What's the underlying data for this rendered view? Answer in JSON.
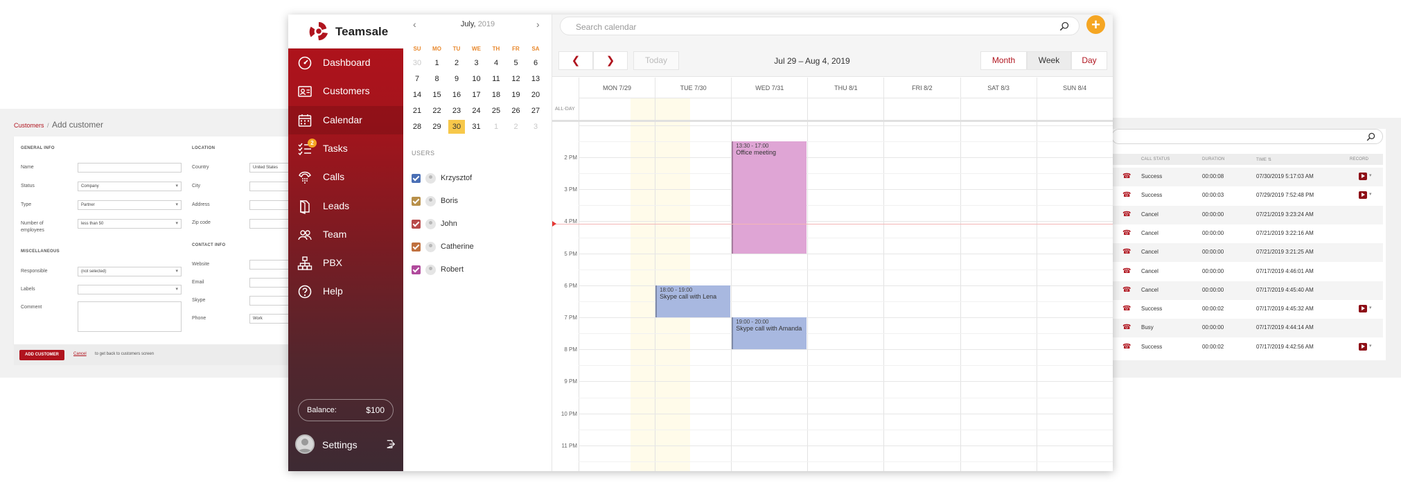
{
  "add_customer": {
    "breadcrumb_link": "Customers",
    "breadcrumb_sep": "/",
    "title": "Add customer",
    "general_info": "GENERAL INFO",
    "miscellaneous": "MISCELLANEOUS",
    "location": "LOCATION",
    "contact_info": "CONTACT INFO",
    "fields": {
      "name": "Name",
      "status": "Status",
      "status_value": "Company",
      "type": "Type",
      "type_value": "Partner",
      "employees": "Number of employees",
      "employees_value": "less than 50",
      "responsible": "Responsible",
      "responsible_value": "(not selected)",
      "labels": "Labels",
      "comment": "Comment",
      "country": "Country",
      "country_value": "United States",
      "city": "City",
      "address": "Address",
      "zip": "Zip code",
      "website": "Website",
      "email": "Email",
      "skype": "Skype",
      "phone": "Phone",
      "phone_value": "Work"
    },
    "submit": "ADD CUSTOMER",
    "cancel": "Cancel",
    "cancel_note": "to get back to customers screen"
  },
  "calls": {
    "columns": {
      "status": "CALL STATUS",
      "duration": "DURATION",
      "time": "TIME ⇅",
      "record": "RECORD"
    },
    "rows": [
      {
        "status": "Success",
        "duration": "00:00:08",
        "time": "07/30/2019 5:17:03 AM",
        "record": true
      },
      {
        "status": "Success",
        "duration": "00:00:03",
        "time": "07/29/2019 7:52:48 PM",
        "record": true
      },
      {
        "status": "Cancel",
        "duration": "00:00:00",
        "time": "07/21/2019 3:23:24 AM",
        "record": false
      },
      {
        "status": "Cancel",
        "duration": "00:00:00",
        "time": "07/21/2019 3:22:16 AM",
        "record": false
      },
      {
        "status": "Cancel",
        "duration": "00:00:00",
        "time": "07/21/2019 3:21:25 AM",
        "record": false
      },
      {
        "status": "Cancel",
        "duration": "00:00:00",
        "time": "07/17/2019 4:46:01 AM",
        "record": false
      },
      {
        "status": "Cancel",
        "duration": "00:00:00",
        "time": "07/17/2019 4:45:40 AM",
        "record": false
      },
      {
        "status": "Success",
        "duration": "00:00:02",
        "time": "07/17/2019 4:45:32 AM",
        "record": true
      },
      {
        "status": "Busy",
        "duration": "00:00:00",
        "time": "07/17/2019 4:44:14 AM",
        "record": false
      },
      {
        "status": "Success",
        "duration": "00:00:02",
        "time": "07/17/2019 4:42:56 AM",
        "record": true
      }
    ]
  },
  "brand": {
    "name": "Teamsale",
    "accent": "#b0141e",
    "highlight": "#f5a623"
  },
  "nav": [
    {
      "label": "Dashboard",
      "icon": "dashboard-icon",
      "active": false
    },
    {
      "label": "Customers",
      "icon": "customers-icon",
      "active": false
    },
    {
      "label": "Calendar",
      "icon": "calendar-icon",
      "active": true
    },
    {
      "label": "Tasks",
      "icon": "tasks-icon",
      "active": false,
      "badge": "2"
    },
    {
      "label": "Calls",
      "icon": "phone-icon",
      "active": false
    },
    {
      "label": "Leads",
      "icon": "leads-icon",
      "active": false
    },
    {
      "label": "Team",
      "icon": "team-icon",
      "active": false
    },
    {
      "label": "PBX",
      "icon": "pbx-icon",
      "active": false
    },
    {
      "label": "Help",
      "icon": "help-icon",
      "active": false
    }
  ],
  "balance": {
    "label": "Balance:",
    "value": "$100"
  },
  "settings": {
    "label": "Settings"
  },
  "mini_calendar": {
    "month": "July,",
    "year": "2019",
    "weekdays": [
      "SU",
      "MO",
      "TU",
      "WE",
      "TH",
      "FR",
      "SA"
    ],
    "weeks": [
      [
        "30",
        "1",
        "2",
        "3",
        "4",
        "5",
        "6"
      ],
      [
        "7",
        "8",
        "9",
        "10",
        "11",
        "12",
        "13"
      ],
      [
        "14",
        "15",
        "16",
        "17",
        "18",
        "19",
        "20"
      ],
      [
        "21",
        "22",
        "23",
        "24",
        "25",
        "26",
        "27"
      ],
      [
        "28",
        "29",
        "30",
        "31",
        "1",
        "2",
        "3"
      ]
    ],
    "selected": "30"
  },
  "users": {
    "title": "USERS",
    "list": [
      {
        "name": "Krzysztof",
        "color": "#4a6fb5"
      },
      {
        "name": "Boris",
        "color": "#b8904a"
      },
      {
        "name": "John",
        "color": "#b84a4a"
      },
      {
        "name": "Catherine",
        "color": "#c0703e"
      },
      {
        "name": "Robert",
        "color": "#b04a9c"
      }
    ]
  },
  "calendar": {
    "search_placeholder": "Search calendar",
    "today": "Today",
    "range": "Jul 29 – Aug 4, 2019",
    "views": {
      "month": "Month",
      "week": "Week",
      "day": "Day"
    },
    "all_day": "ALL-DAY",
    "days": [
      "MON 7/29",
      "TUE 7/30",
      "WED 7/31",
      "THU 8/1",
      "FRI 8/2",
      "SAT 8/3",
      "SUN 8/4"
    ],
    "hours": [
      "2 PM",
      "3 PM",
      "4 PM",
      "5 PM",
      "6 PM",
      "7 PM",
      "8 PM",
      "9 PM",
      "10 PM",
      "11 PM"
    ],
    "events": [
      {
        "time": "13:30 - 17:00",
        "title": "Office meeting",
        "color": "#dfa5d5"
      },
      {
        "time": "18:00 - 19:00",
        "title": "Skype call with Lena",
        "color": "#a8b8e0"
      },
      {
        "time": "19:00 - 20:00",
        "title": "Skype call with Amanda",
        "color": "#a8b8e0"
      }
    ]
  }
}
